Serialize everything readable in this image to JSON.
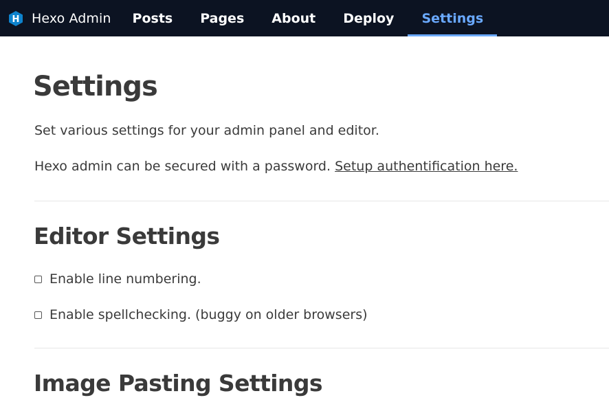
{
  "nav": {
    "brand": "Hexo Admin",
    "brand_icon": "hexo-logo-icon",
    "items": [
      {
        "label": "Posts"
      },
      {
        "label": "Pages"
      },
      {
        "label": "About"
      },
      {
        "label": "Deploy"
      },
      {
        "label": "Settings",
        "active": true
      }
    ],
    "accent_color": "#6aa9ff",
    "background_color": "#0c1322"
  },
  "main": {
    "title": "Settings",
    "intro": "Set various settings for your admin panel and editor.",
    "auth_text": "Hexo admin can be secured with a password.",
    "auth_link": "Setup authentification here.",
    "editor_heading": "Editor Settings",
    "options": [
      {
        "label": "Enable line numbering.",
        "checked": false
      },
      {
        "label": "Enable spellchecking. (buggy on older browsers)",
        "checked": false
      }
    ],
    "image_heading": "Image Pasting Settings"
  }
}
